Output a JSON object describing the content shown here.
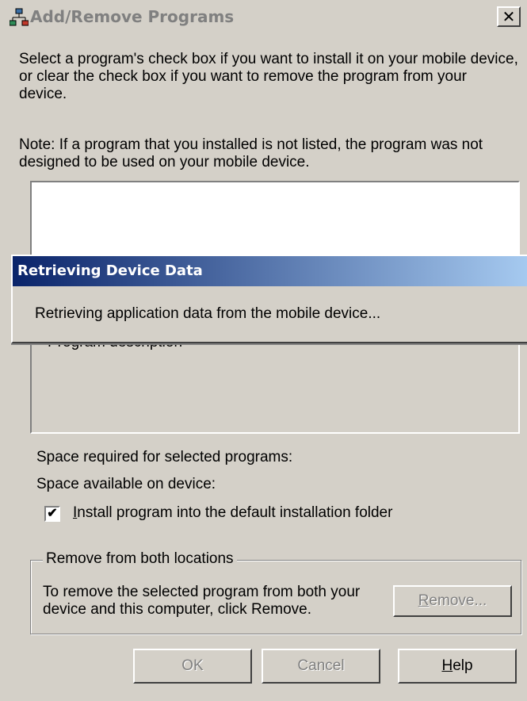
{
  "window": {
    "title": "Add/Remove Programs",
    "close_label": "✕",
    "icon": "add-remove-programs-icon"
  },
  "instructions": {
    "paragraph1": "Select a program's check box if you want to install it on your mobile device, or clear the check box if you want to remove the program from your device.",
    "paragraph2": "Note:  If a program that you installed is not listed, the program was not designed to be used on your mobile device."
  },
  "program_list": {
    "items": []
  },
  "description": {
    "label": "Program description"
  },
  "space": {
    "required_label": "Space required for selected programs:",
    "available_label": "Space available on device:"
  },
  "install_option": {
    "checked": true,
    "mnemonic": "I",
    "label_rest": "nstall program into the default installation folder"
  },
  "remove_group": {
    "legend": "Remove from both locations",
    "text": "To remove the selected program from both your device and this computer, click Remove.",
    "button_mnemonic": "R",
    "button_rest": "emove..."
  },
  "buttons": {
    "ok": "OK",
    "cancel": "Cancel",
    "help_mnemonic": "H",
    "help_rest": "elp"
  },
  "progress_dialog": {
    "title": "Retrieving Device Data",
    "message": "Retrieving application data from the mobile device..."
  },
  "colors": {
    "face": "#d4d0c8",
    "active_title_start": "#0a246a",
    "active_title_end": "#a6caf0",
    "inactive_title_text": "#808080"
  }
}
